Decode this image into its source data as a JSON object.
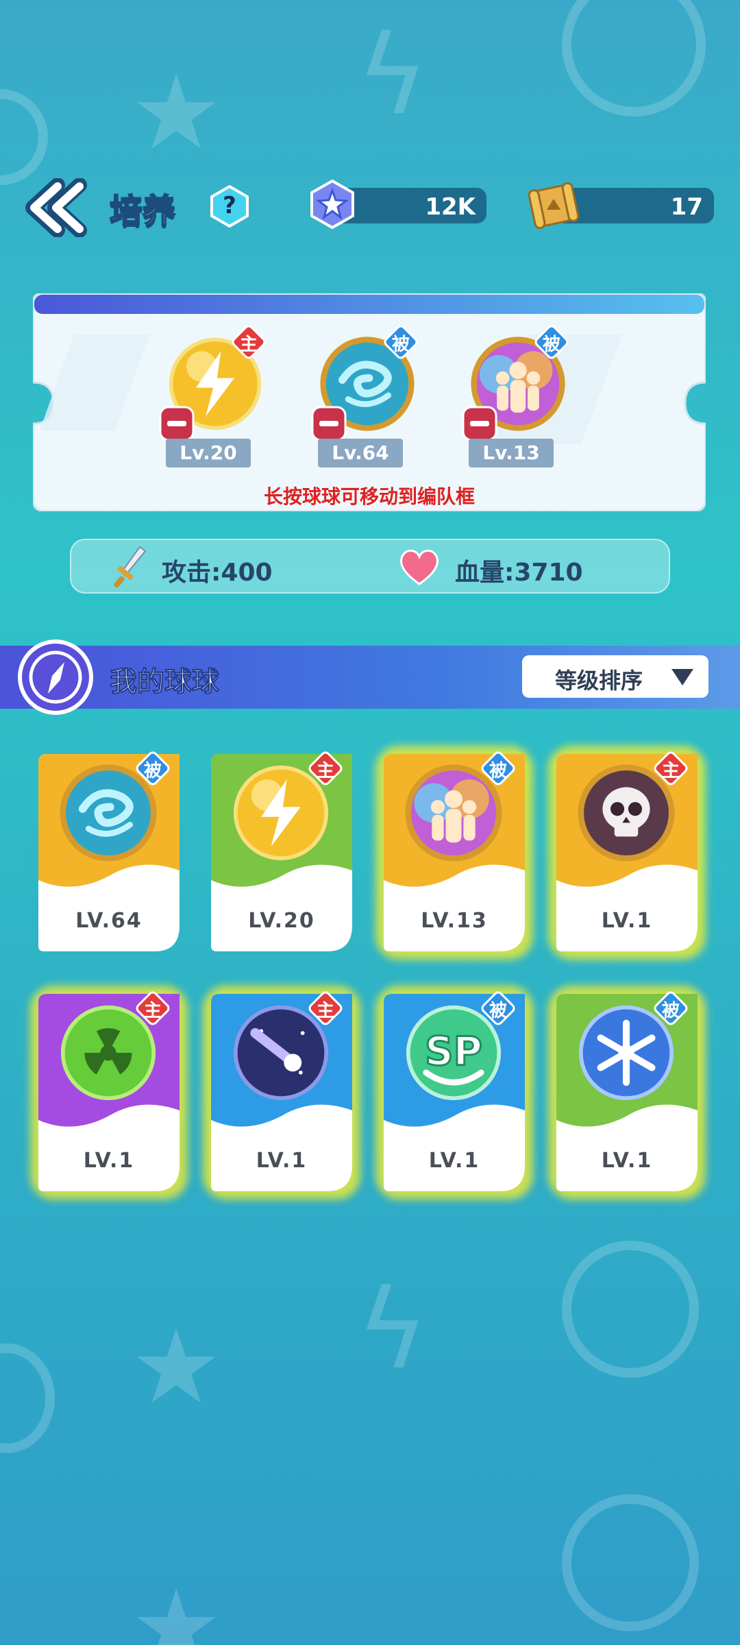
{
  "header": {
    "title": "培养",
    "help": "?",
    "gems": "12K",
    "scrolls": "17"
  },
  "team": {
    "slots": [
      {
        "level": "Lv.20",
        "tag": "主",
        "orb": "lightning-orb-icon"
      },
      {
        "level": "Lv.64",
        "tag": "被",
        "orb": "swirl-orb-icon"
      },
      {
        "level": "Lv.13",
        "tag": "被",
        "orb": "crowd-orb-icon"
      }
    ],
    "hint": "长按球球可移动到编队框"
  },
  "stats": {
    "attack": "攻击:400",
    "hp": "血量:3710"
  },
  "section": {
    "title": "我的球球",
    "sort_label": "等级排序"
  },
  "balls": [
    {
      "level": "LV.64",
      "tag": "被",
      "orb": "swirl-orb-icon",
      "color": "#f3b42a"
    },
    {
      "level": "LV.20",
      "tag": "主",
      "orb": "lightning-orb-icon",
      "color": "#7cc443"
    },
    {
      "level": "LV.13",
      "tag": "被",
      "orb": "crowd-orb-icon",
      "color": "#f3b42a"
    },
    {
      "level": "LV.1",
      "tag": "主",
      "orb": "skull-orb-icon",
      "color": "#f3b42a"
    },
    {
      "level": "LV.1",
      "tag": "主",
      "orb": "radiation-orb-icon",
      "color": "#a44be2"
    },
    {
      "level": "LV.1",
      "tag": "主",
      "orb": "meteor-orb-icon",
      "color": "#2e9be6"
    },
    {
      "level": "LV.1",
      "tag": "被",
      "orb": "sp-orb-icon",
      "color": "#2e9be6"
    },
    {
      "level": "LV.1",
      "tag": "被",
      "orb": "snowflake-orb-icon",
      "color": "#7cc443"
    }
  ],
  "colors": {
    "active_tag": "#e23c3c",
    "passive_tag": "#2f8fe0",
    "card_glow": "#fff028"
  }
}
